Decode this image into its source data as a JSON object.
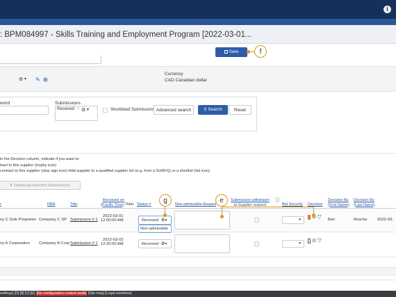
{
  "header": {
    "info_icon": "info-icon"
  },
  "page": {
    "title": ": BPM084997 - Skills Training and Employment Program [2022-03-01..."
  },
  "toolbar": {
    "save_label": "Save",
    "save_icon": "save-icon"
  },
  "callouts": {
    "f": "f",
    "g": "g",
    "e": "e"
  },
  "details": {
    "currency_label": "Currency",
    "currency_value": "CAD Canadian dollar",
    "top_truncated": ""
  },
  "search": {
    "keyword_label": "word",
    "submissions_label": "Submissions",
    "submissions_tag": "Received",
    "submissions_tag_remove": "×",
    "shortlisted_label": "Shortlisted Submissions only",
    "advanced_search_label": "Advanced search",
    "search_label": "Search",
    "reset_label": "Reset"
  },
  "instructions": {
    "line1": "in the Decision column, indicate if you want to:",
    "line2": "tract to this supplier (trophy icon)",
    "line3": "contract to this supplier (stop sign icon)-Add supplier to a qualified supplier list (e.g. from a SURFQ) or a shortlist (list icon)"
  },
  "download_label": "Download selected Submissions",
  "table": {
    "headers": {
      "supplier": "r",
      "dba": "DBA",
      "title": "Title",
      "received_on_1": "Received on",
      "received_on_2": "(Pacific Time)",
      "total": "Total",
      "status": "Status",
      "non_admissible": "Non-admissible Reason",
      "withdrawn_1": "Submission withdrawn",
      "withdrawn_2": "at Supplier request",
      "bid_security": "Bid Security",
      "decision": "Decision",
      "decision_by_first_1": "Decision By",
      "decision_by_first_2": "(First Name)",
      "decision_by_last_1": "Decision By",
      "decision_by_last_2": "(Last Name)"
    },
    "rows": [
      {
        "supplier": "ny C Sole Proprietor",
        "dba": "Company C SP",
        "title": "Submission # 1",
        "received_date": "2022-03-01",
        "received_time": "12:00:00 AM",
        "status": "Received",
        "status_dropdown_option": "Non-admissible",
        "first_name": "Ben",
        "last_name": "Rosche",
        "date": "2022-03-"
      },
      {
        "supplier": "ny A Corporation",
        "dba": "Company A Corp",
        "title": "Submission # 1",
        "received_date": "2022-03-02",
        "received_time": "12:30:00 AM",
        "status": "Received",
        "first_name": "",
        "last_name": "",
        "date": ""
      }
    ]
  },
  "footer": {
    "prefix": "settings] [D] [$] [V] [E] ",
    "red": "[No configuration context audit]",
    "suffix": " [Site map] [Legal mentions]"
  },
  "colors": {
    "topbar": "#16305a",
    "primary": "#2d5da8",
    "callout": "#d49a1b",
    "decision_flag": "#e8742a"
  }
}
